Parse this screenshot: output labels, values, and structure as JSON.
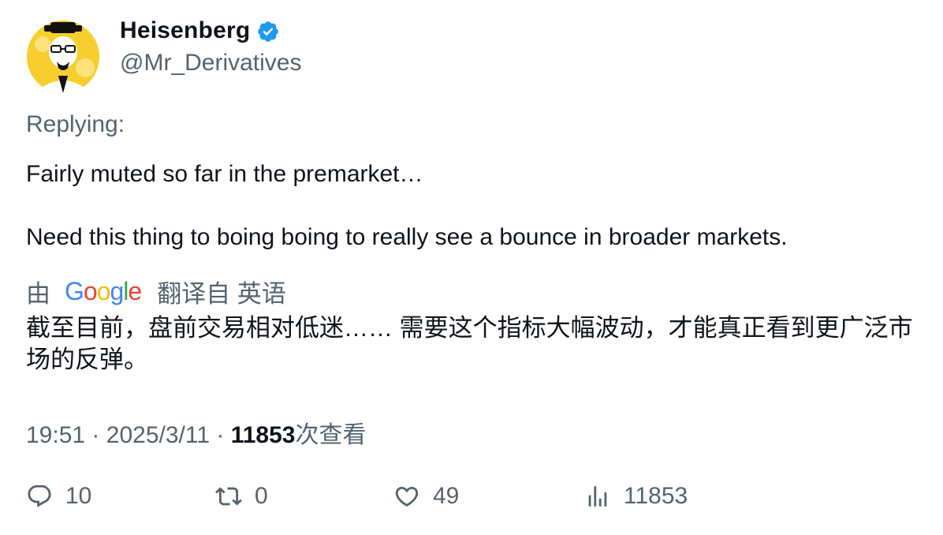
{
  "author": {
    "name": "Heisenberg",
    "handle": "@Mr_Derivatives"
  },
  "replying_label": "Replying:",
  "tweet": {
    "line1": "Fairly muted so far in the premarket…",
    "line2": "Need this thing to boing boing to really see a bounce in broader markets."
  },
  "translation": {
    "by_label": "由",
    "provider": "Google",
    "from_label": "翻译自 英语",
    "text": "截至目前，盘前交易相对低迷…… 需要这个指标大幅波动，才能真正看到更广泛市场的反弹。"
  },
  "meta": {
    "time": "19:51",
    "sep": "·",
    "date": "2025/3/11",
    "views_count": "11853",
    "views_label": "次查看"
  },
  "actions": {
    "replies": "10",
    "retweets": "0",
    "likes": "49",
    "views": "11853"
  },
  "colors": {
    "verified": "#1d9bf0",
    "secondary_text": "#536471",
    "primary_text": "#0f1419",
    "avatar_bg": "#f6cf2e"
  },
  "icons": [
    "verified-badge-icon",
    "reply-icon",
    "retweet-icon",
    "like-icon",
    "views-icon",
    "google-logo"
  ]
}
